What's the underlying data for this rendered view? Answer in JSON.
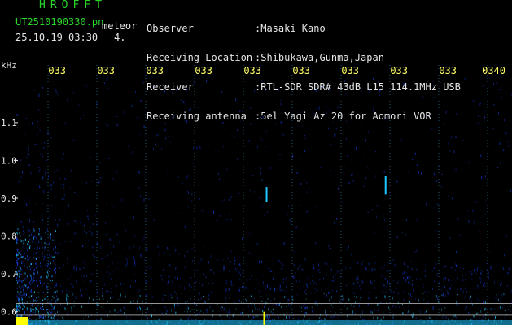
{
  "header": {
    "brand": "HROFFT",
    "filename": "UT2510190330.pn",
    "meteor_label": "meteor",
    "datetime": "25.10.19 03:30",
    "count": "4.",
    "observer_label": "Observer",
    "observer": ":Masaki Kano",
    "location_label": "Receiving Location",
    "location": ":Shibukawa,Gunma,Japan",
    "receiver_label": "Receiver",
    "receiver": ":RTL-SDR SDR# 43dB L15 114.1MHz USB",
    "antenna_label": "Receiving antenna",
    "antenna": ":5el Yagi Az 20 for Aomori VOR"
  },
  "colors": {
    "background": "#000000",
    "text_green": "#2bd62b",
    "text_white": "#e6e6e6",
    "time_label_yellow": "#ffff66",
    "grid_line": "#2a6e8a",
    "noise_blue": "#1438c8",
    "noise_cyan": "#20c8ff",
    "band_yellow": "#ffff00"
  },
  "chart_data": {
    "type": "heatmap",
    "ylabel": "kHz",
    "x_tick_labels": [
      "033",
      "033",
      "033",
      "033",
      "033",
      "033",
      "033",
      "033",
      "033",
      "0340"
    ],
    "y_ticks": [
      1.1,
      1.0,
      0.9,
      0.8,
      0.7,
      0.6
    ],
    "y_tick_labels": [
      "1.1",
      "1.0",
      "0.9",
      "0.8",
      "0.7",
      "0.6"
    ],
    "ylim": [
      0.565,
      1.22
    ],
    "xlim": [
      0,
      10
    ],
    "horizontal_reference_lines_khz": [
      0.622,
      0.591
    ],
    "echoes": [
      {
        "x": 5.05,
        "y_low": 0.89,
        "y_high": 0.93
      },
      {
        "x": 7.45,
        "y_low": 0.91,
        "y_high": 0.96
      },
      {
        "x": 5.0,
        "y_low": 0.565,
        "y_high": 0.6
      }
    ]
  }
}
